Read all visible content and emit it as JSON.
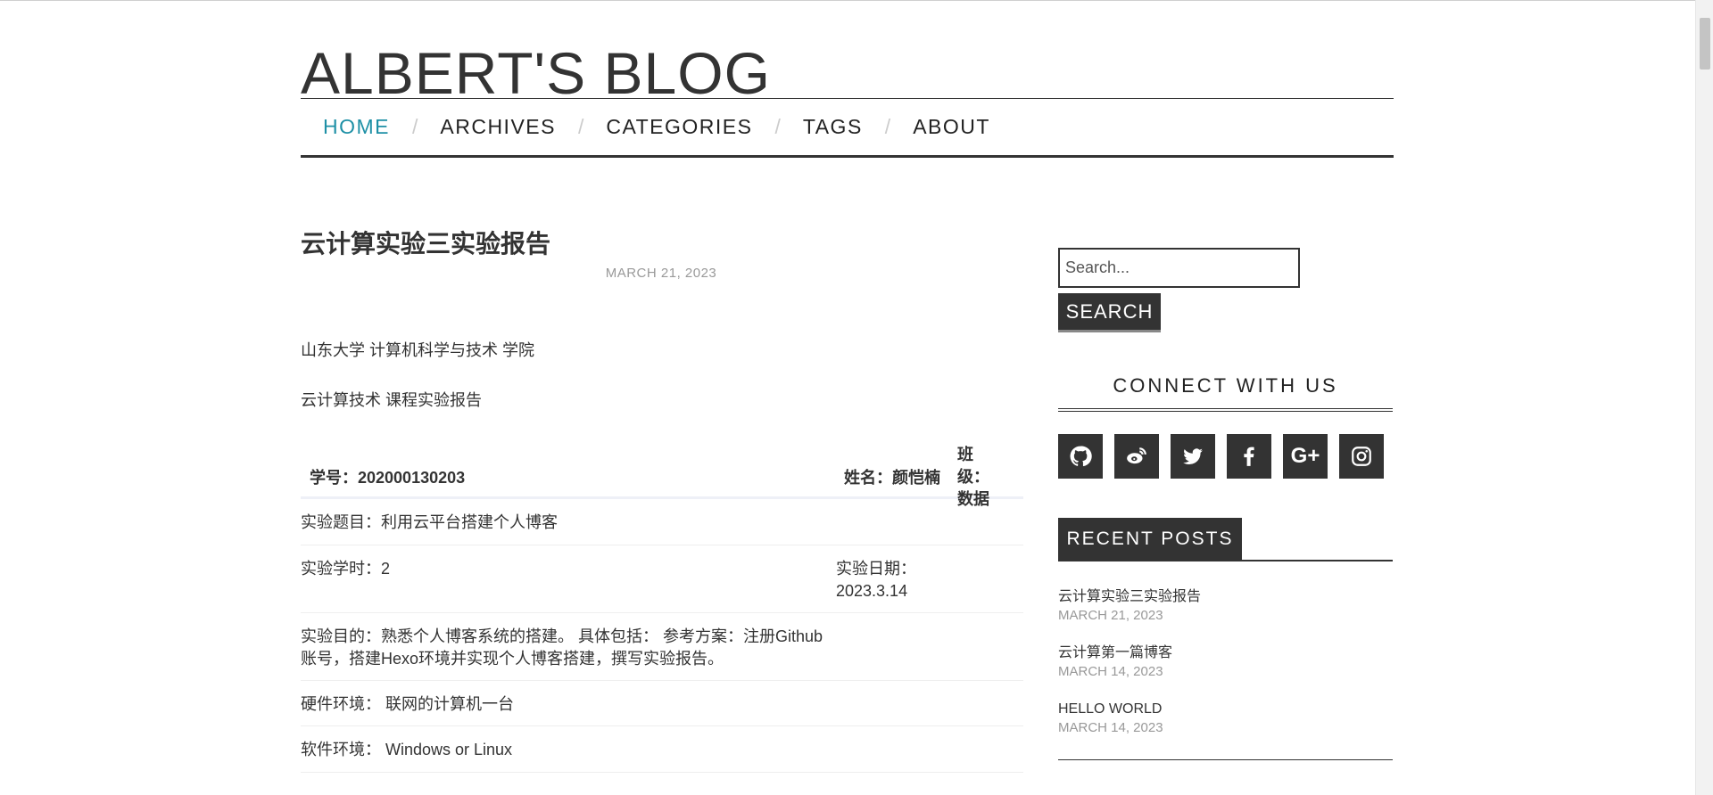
{
  "site": {
    "title": "ALBERT'S BLOG"
  },
  "nav": {
    "items": [
      "HOME",
      "ARCHIVES",
      "CATEGORIES",
      "TAGS",
      "ABOUT"
    ],
    "active": "HOME",
    "separator": "/"
  },
  "post": {
    "title": "云计算实验三实验报告",
    "date": "MARCH 21, 2023",
    "paragraphs": [
      "山东大学 计算机科学与技术 学院",
      "云计算技术 课程实验报告"
    ],
    "table": {
      "headers": [
        "学号：202000130203",
        "姓名：颜恺楠",
        "班级：数据"
      ],
      "rows": [
        {
          "left": "实验题目：利用云平台搭建个人博客",
          "right": ""
        },
        {
          "left": "实验学时：2",
          "right": "实验日期：2023.3.14"
        },
        {
          "left": "实验目的：熟悉个人博客系统的搭建。 具体包括： 参考方案：注册Github账号，搭建Hexo环境并实现个人博客搭建，撰写实验报告。",
          "right": ""
        },
        {
          "left": "硬件环境： 联网的计算机一台",
          "right": ""
        },
        {
          "left": "软件环境： Windows or Linux",
          "right": ""
        }
      ]
    }
  },
  "sidebar": {
    "search": {
      "placeholder": "Search...",
      "button": "SEARCH"
    },
    "connect": {
      "title": "CONNECT WITH US",
      "icons": [
        "github-icon",
        "weibo-icon",
        "twitter-icon",
        "facebook-icon",
        "google-plus-icon",
        "instagram-icon"
      ]
    },
    "recent": {
      "title": "RECENT POSTS",
      "posts": [
        {
          "title": "云计算实验三实验报告",
          "date": "MARCH 21, 2023"
        },
        {
          "title": "云计算第一篇博客",
          "date": "MARCH 14, 2023"
        },
        {
          "title": "HELLO WORLD",
          "date": "MARCH 14, 2023"
        }
      ]
    }
  },
  "colors": {
    "accent": "#1e90a6",
    "dark": "#333333",
    "muted": "#999999"
  }
}
